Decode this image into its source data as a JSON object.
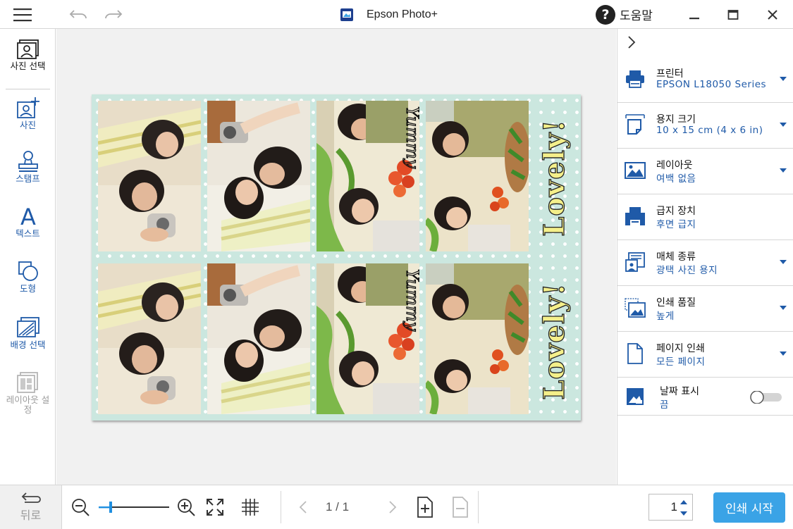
{
  "titlebar": {
    "app_title": "Epson Photo+",
    "help_label": "도움말"
  },
  "icons": {
    "menu": "hamburger-icon",
    "undo": "undo-icon",
    "redo": "redo-icon",
    "help": "question-circle-icon",
    "minimize": "minimize-icon",
    "maximize": "maximize-icon",
    "close": "close-icon"
  },
  "tools": [
    {
      "label": "사진 선택"
    },
    {
      "label": "사진"
    },
    {
      "label": "스탬프"
    },
    {
      "label": "텍스트"
    },
    {
      "label": "도형"
    },
    {
      "label": "배경 선택"
    },
    {
      "label": "레이아웃 설정"
    }
  ],
  "canvas": {
    "overlay_text": "Lovely!",
    "photo_handwriting": "Yummy"
  },
  "settings": [
    {
      "title": "프린터",
      "value": "EPSON L18050 Series"
    },
    {
      "title": "용지 크기",
      "value": "10 x 15 cm (4 x 6 in)"
    },
    {
      "title": "레이아웃",
      "value": "여백 없음"
    },
    {
      "title": "급지 장치",
      "value": "후면 급지"
    },
    {
      "title": "매체 종류",
      "value": "광택 사진 용지"
    },
    {
      "title": "인쇄 품질",
      "value": "높게"
    },
    {
      "title": "페이지 인쇄",
      "value": "모든 페이지"
    },
    {
      "title": "날짜 표시",
      "value": "끔"
    }
  ],
  "date_toggle": {
    "on": false
  },
  "bottombar": {
    "back_label": "뒤로",
    "zoom_level": 0.15,
    "page_indicator": "1 / 1",
    "copies": "1",
    "print_button": "인쇄 시작"
  },
  "colors": {
    "accent": "#1f5aa8",
    "print_button": "#3aa3e6",
    "paper_background": "#cbe7df"
  }
}
